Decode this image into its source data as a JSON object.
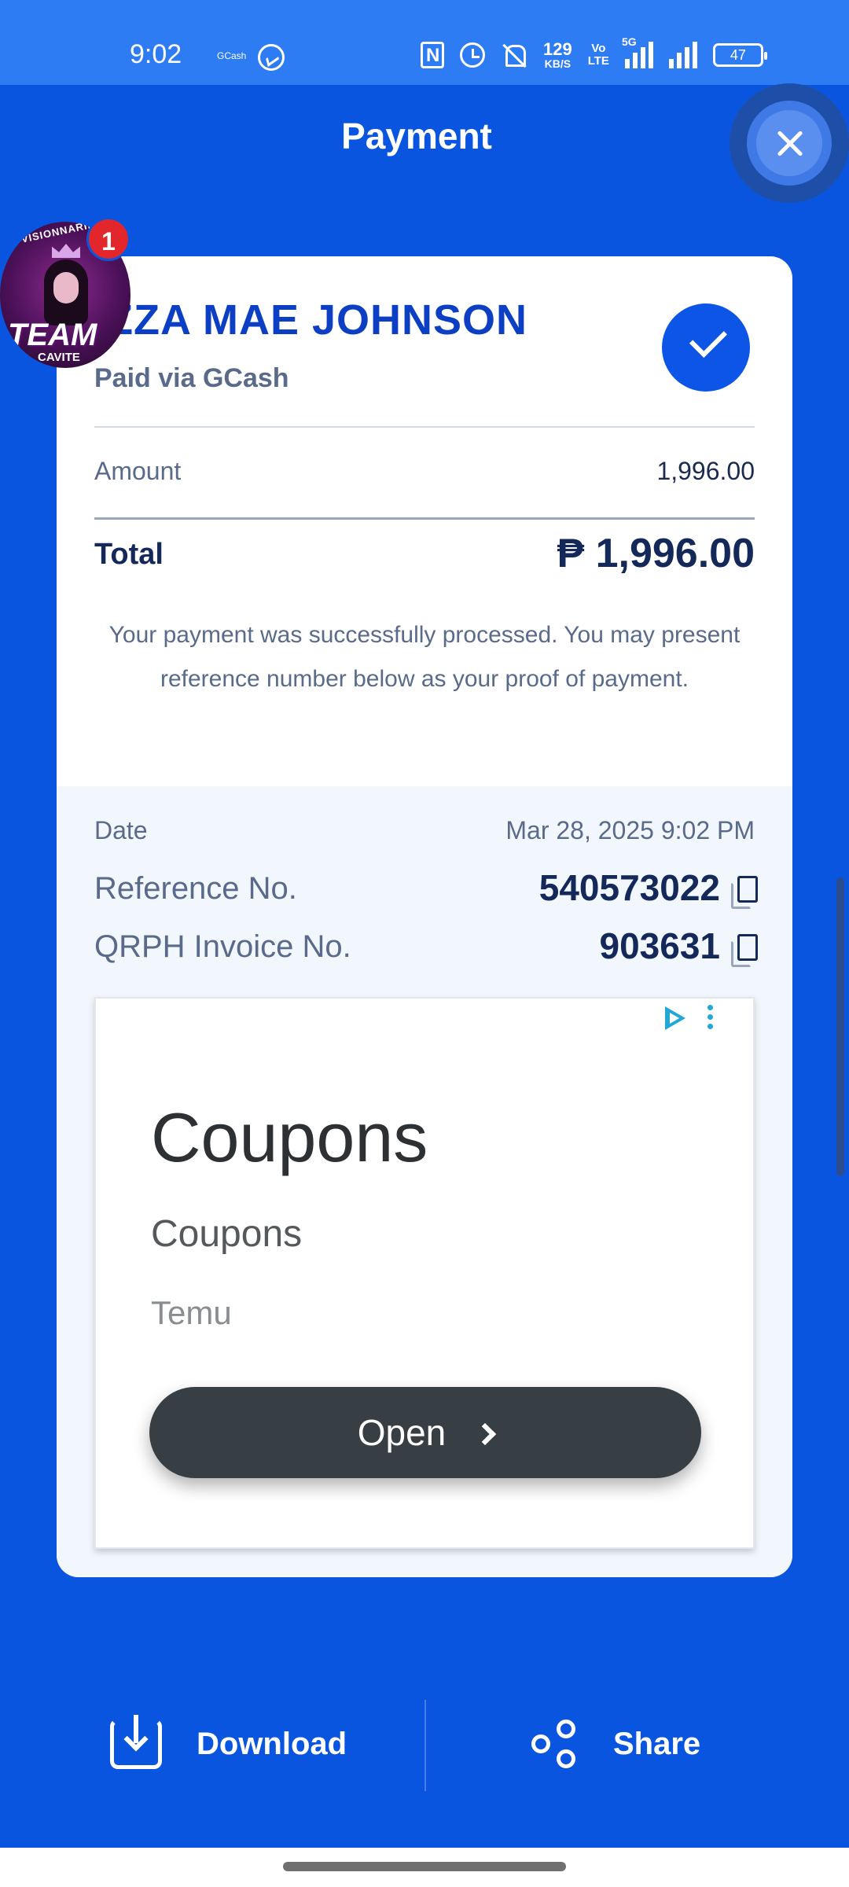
{
  "status_bar": {
    "time": "9:02",
    "notification_app": "GCash",
    "network_speed": "129",
    "network_speed_unit": "KB/S",
    "volte": "Vo\nLTED",
    "network_type": "5G",
    "battery": "47"
  },
  "header": {
    "title": "Payment",
    "close_icon": "close-icon"
  },
  "receipt": {
    "recipient_name": "IZZA MAE JOHNSON",
    "paid_via": "Paid via GCash",
    "status_icon": "check-icon",
    "amount_label": "Amount",
    "amount_value": "1,996.00",
    "total_label": "Total",
    "total_value": "₱ 1,996.00",
    "message": "Your payment was successfully processed. You may present reference number below as your proof of payment.",
    "date_label": "Date",
    "date_value": "Mar 28, 2025 9:02 PM",
    "reference_label": "Reference No.",
    "reference_value": "540573022",
    "invoice_label": "QRPH Invoice No.",
    "invoice_value": "903631"
  },
  "ad": {
    "headline": "Coupons",
    "subheadline": "Coupons",
    "advertiser": "Temu",
    "cta_label": "Open"
  },
  "floating_bubble": {
    "top_text": "VISIONNARIES",
    "team_text": "TEAM",
    "bottom_text": "CAVITE",
    "badge_count": "1"
  },
  "actions": {
    "download_label": "Download",
    "share_label": "Share"
  },
  "colors": {
    "background": "#0a55e0",
    "accent": "#0d3fc4",
    "text_dark": "#14295a",
    "text_muted": "#5a6a8a",
    "badge": "#e3262b"
  }
}
